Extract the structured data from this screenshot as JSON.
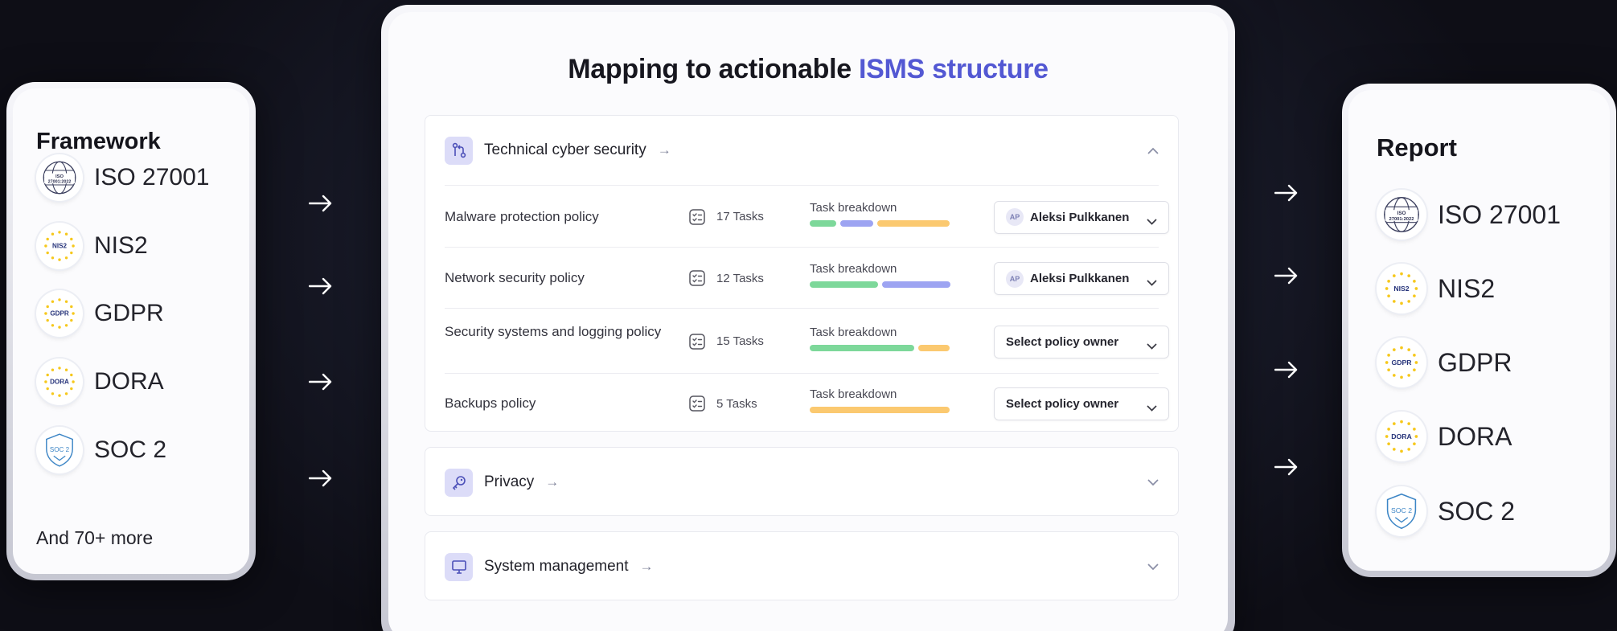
{
  "framework": {
    "title": "Framework",
    "items": [
      {
        "label": "ISO 27001",
        "badge": "ISO\n27001:2022"
      },
      {
        "label": "NIS2",
        "badge": "NIS2"
      },
      {
        "label": "GDPR",
        "badge": "GDPR"
      },
      {
        "label": "DORA",
        "badge": "DORA"
      },
      {
        "label": "SOC 2",
        "badge": "SOC 2"
      }
    ],
    "more": "And 70+ more"
  },
  "main": {
    "title_prefix": "Mapping to actionable ",
    "title_accent": "ISMS structure",
    "sections": [
      {
        "label": "Technical cyber security",
        "icon": "branch-icon",
        "expanded": true,
        "policies": [
          {
            "name": "Malware protection policy",
            "tasks": "17 Tasks",
            "breakdown_label": "Task breakdown",
            "breakdown": [
              {
                "color": "#7dd89a",
                "share": 0.2
              },
              {
                "color": "#9da4f2",
                "share": 0.25
              },
              {
                "color": "#fbc970",
                "share": 0.55
              }
            ],
            "owner": "Aleksi Pulkkanen",
            "initials": "AP"
          },
          {
            "name": "Network security policy",
            "tasks": "12 Tasks",
            "breakdown_label": "Task breakdown",
            "breakdown": [
              {
                "color": "#7dd89a",
                "share": 0.5
              },
              {
                "color": "#9da4f2",
                "share": 0.5
              }
            ],
            "owner": "Aleksi Pulkkanen",
            "initials": "AP"
          },
          {
            "name": "Security systems and logging policy",
            "tasks": "15 Tasks",
            "breakdown_label": "Task breakdown",
            "breakdown": [
              {
                "color": "#7dd89a",
                "share": 0.77
              },
              {
                "color": "#fbc970",
                "share": 0.23
              }
            ],
            "owner": "Select policy owner",
            "initials": ""
          },
          {
            "name": "Backups policy",
            "tasks": "5 Tasks",
            "breakdown_label": "Task breakdown",
            "breakdown": [
              {
                "color": "#fbc970",
                "share": 1.0
              }
            ],
            "owner": "Select policy owner",
            "initials": ""
          }
        ]
      },
      {
        "label": "Privacy",
        "icon": "key-icon",
        "expanded": false
      },
      {
        "label": "System management",
        "icon": "monitor-icon",
        "expanded": false
      }
    ]
  },
  "report": {
    "title": "Report",
    "items": [
      {
        "label": "ISO 27001",
        "badge": "ISO\n27001:2022"
      },
      {
        "label": "NIS2",
        "badge": "NIS2"
      },
      {
        "label": "GDPR",
        "badge": "GDPR"
      },
      {
        "label": "DORA",
        "badge": "DORA"
      },
      {
        "label": "SOC 2",
        "badge": "SOC 2"
      }
    ]
  },
  "colors": {
    "accent": "#5358d3",
    "icon_bg": "#dcdcf8",
    "eu_star": "#f6c81c",
    "eu_blue": "#26337a"
  }
}
